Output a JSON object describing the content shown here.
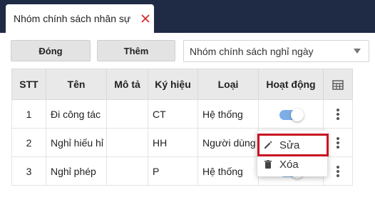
{
  "tab": {
    "label": "Nhóm chính sách nhân sự",
    "close_color": "#d62b2b"
  },
  "toolbar": {
    "close_label": "Đóng",
    "add_label": "Thêm"
  },
  "filter": {
    "selected": "Nhóm chính sách nghỉ ngày"
  },
  "table": {
    "headers": {
      "stt": "STT",
      "name": "Tên",
      "desc": "Mô tả",
      "symbol": "Ký hiệu",
      "type": "Loại",
      "active": "Hoạt động"
    },
    "rows": [
      {
        "stt": "1",
        "name": "Đi công tác",
        "desc": "",
        "symbol": "CT",
        "type": "Hệ thống",
        "active": true
      },
      {
        "stt": "2",
        "name": "Nghỉ hiếu hỉ",
        "desc": "",
        "symbol": "HH",
        "type": "Người dùng",
        "active": true
      },
      {
        "stt": "3",
        "name": "Nghỉ phép",
        "desc": "",
        "symbol": "P",
        "type": "Hệ thống",
        "active": true
      }
    ]
  },
  "context_menu": {
    "edit_label": "Sửa",
    "delete_label": "Xóa"
  },
  "colors": {
    "topbar": "#1f2b45",
    "toggle_on": "#7eaee6",
    "highlight": "#c8131f"
  }
}
